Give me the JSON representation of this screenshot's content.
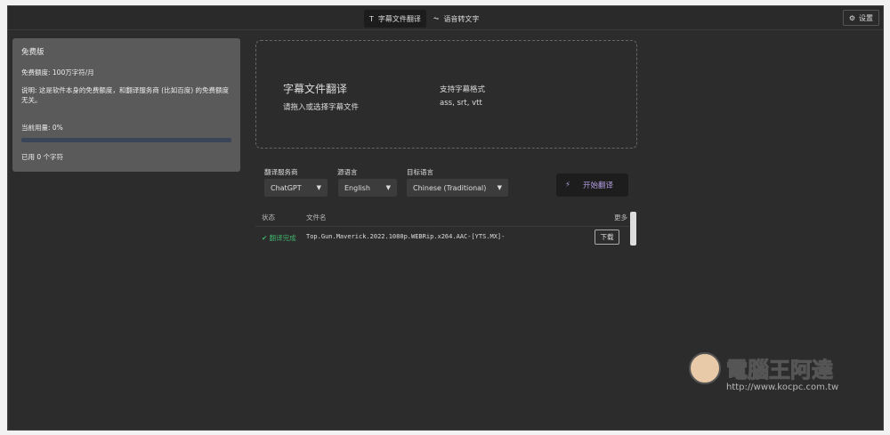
{
  "topbar": {
    "tabs": [
      {
        "label": "字幕文件翻译",
        "icon": "text-icon",
        "active": true
      },
      {
        "label": "语音转文字",
        "icon": "waveform-icon",
        "active": false
      }
    ],
    "settings_label": "设置"
  },
  "plan": {
    "title": "免费版",
    "quota": "免费额度: 100万字符/月",
    "note": "说明: 这是软件本身的免费额度，和翻译服务商 (比如百度) 的免费额度无关。",
    "usage_label": "当前用量: 0%",
    "usage_percent": 0,
    "used": "已用 0 个字符"
  },
  "dropzone": {
    "title": "字幕文件翻译",
    "hint": "请拖入或选择字幕文件",
    "formats_title": "支持字幕格式",
    "formats": "ass, srt, vtt"
  },
  "controls": {
    "service_label": "翻译服务商",
    "service_value": "ChatGPT",
    "source_label": "源语言",
    "source_value": "English",
    "target_label": "目标语言",
    "target_value": "Chinese (Traditional)",
    "start_label": "开始翻译"
  },
  "table": {
    "headers": {
      "status": "状态",
      "filename": "文件名",
      "more": "更多"
    },
    "rows": [
      {
        "status": "翻译完成",
        "filename": "Top.Gun.Maverick.2022.1080p.WEBRip.x264.AAC-[YTS.MX]-",
        "action": "下载"
      }
    ]
  },
  "watermark": {
    "name": "電腦王阿達",
    "url": "http://www.kocpc.com.tw"
  },
  "colors": {
    "success": "#3fb36b",
    "accent": "#b39ce0"
  }
}
